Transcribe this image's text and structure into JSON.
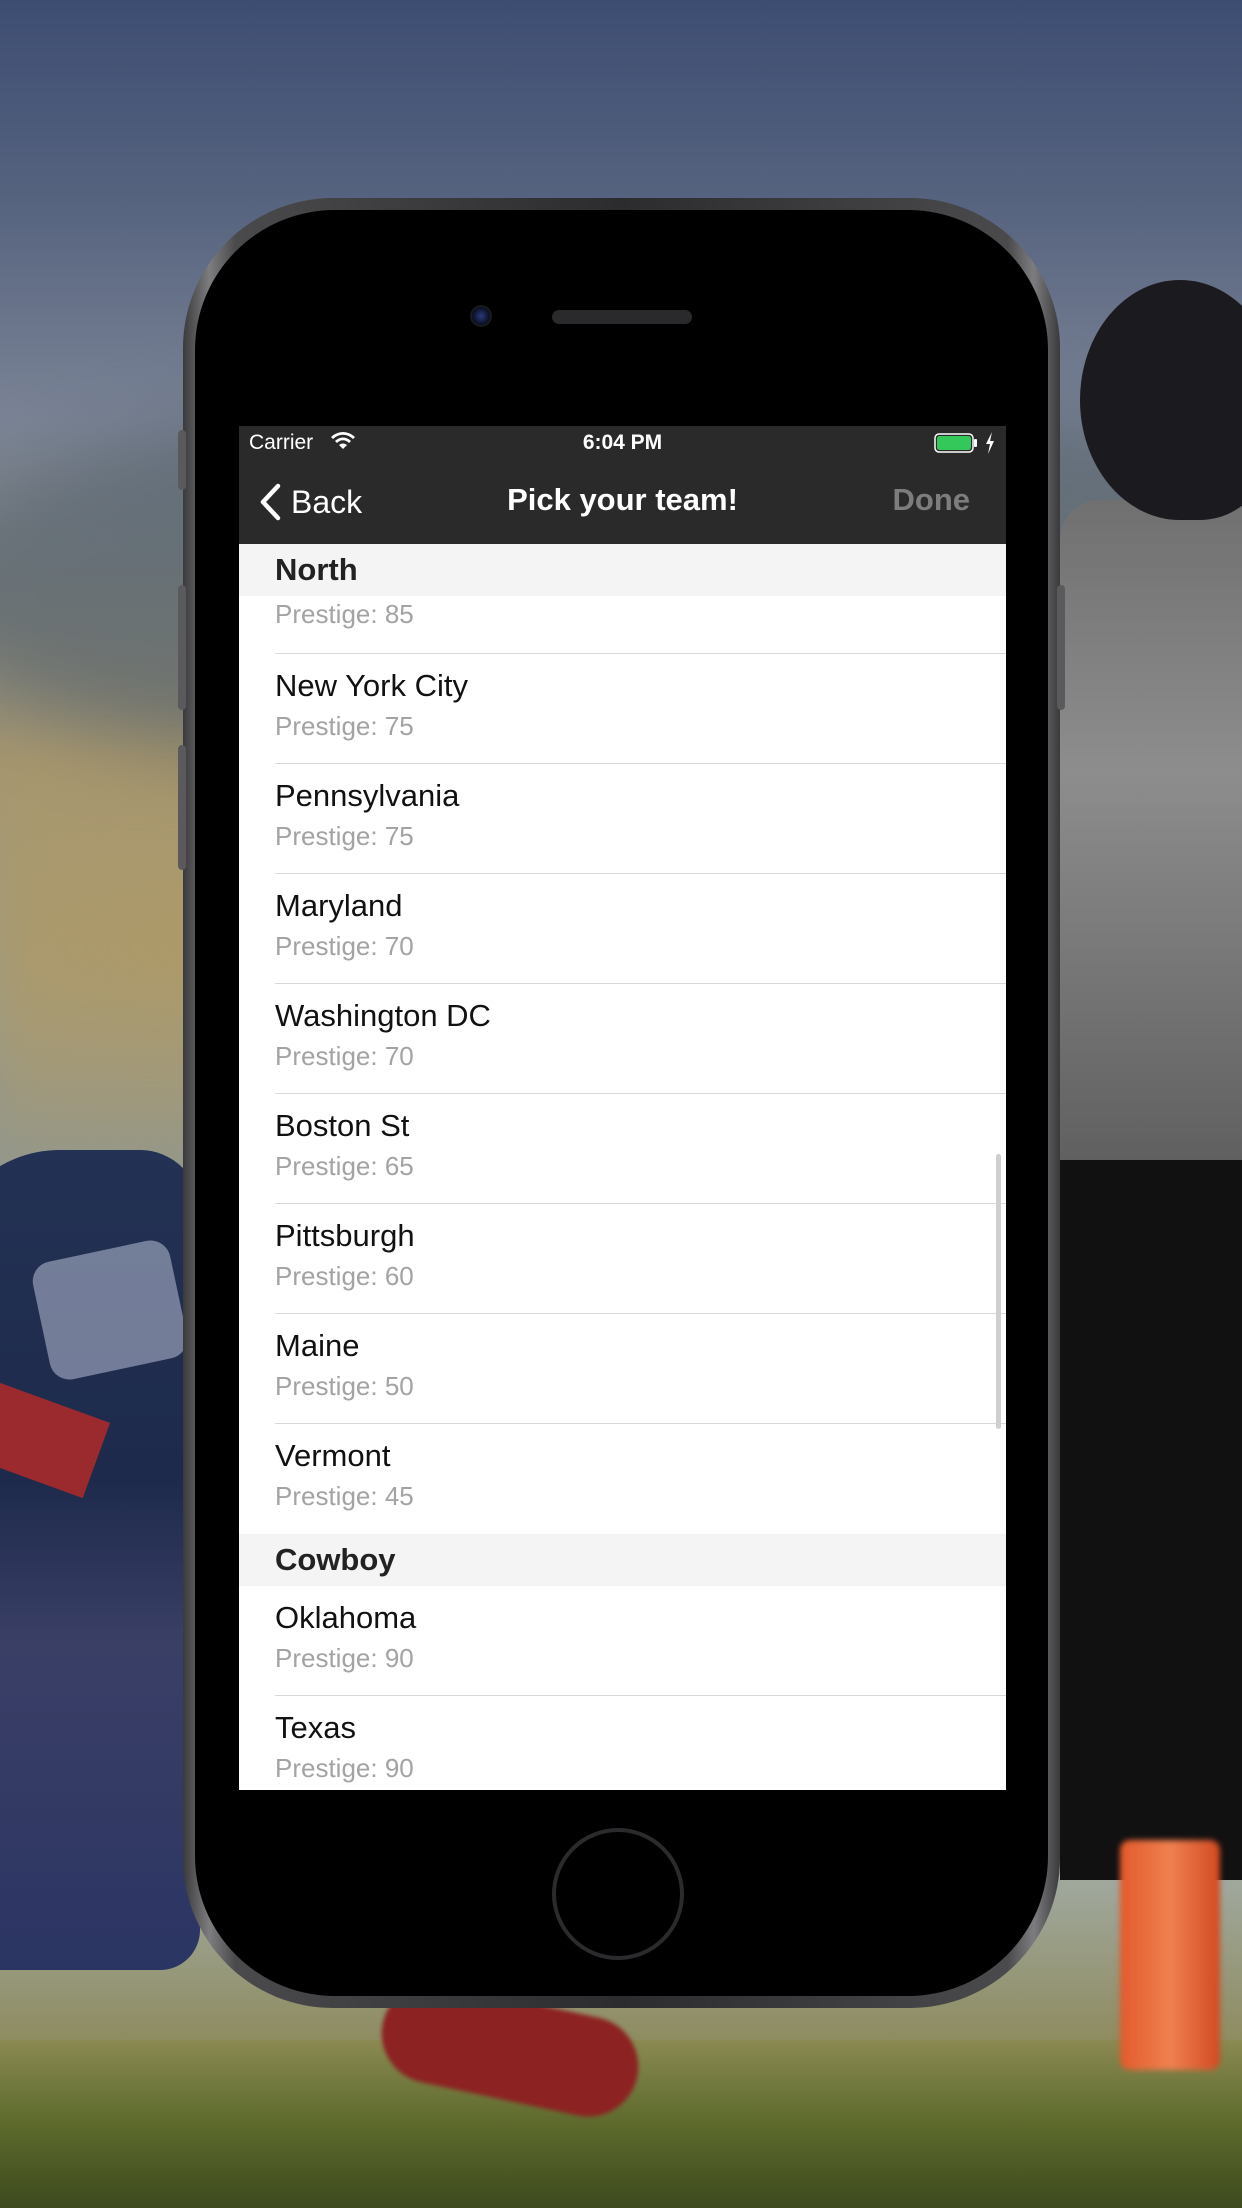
{
  "status_bar": {
    "carrier": "Carrier",
    "time": "6:04 PM",
    "battery_color": "#34c759"
  },
  "nav": {
    "back_label": "Back",
    "title": "Pick your team!",
    "done_label": "Done"
  },
  "list": {
    "sections": [
      {
        "header": "North",
        "partial_top_subtitle": "Prestige: 85",
        "rows": [
          {
            "name": "New York City",
            "prestige": "Prestige: 75"
          },
          {
            "name": "Pennsylvania",
            "prestige": "Prestige: 75"
          },
          {
            "name": "Maryland",
            "prestige": "Prestige: 70"
          },
          {
            "name": "Washington DC",
            "prestige": "Prestige: 70"
          },
          {
            "name": "Boston St",
            "prestige": "Prestige: 65"
          },
          {
            "name": "Pittsburgh",
            "prestige": "Prestige: 60"
          },
          {
            "name": "Maine",
            "prestige": "Prestige: 50"
          },
          {
            "name": "Vermont",
            "prestige": "Prestige: 45"
          }
        ]
      },
      {
        "header": "Cowboy",
        "rows": [
          {
            "name": "Oklahoma",
            "prestige": "Prestige: 90"
          },
          {
            "name": "Texas",
            "prestige": "Prestige: 90"
          }
        ]
      }
    ]
  }
}
